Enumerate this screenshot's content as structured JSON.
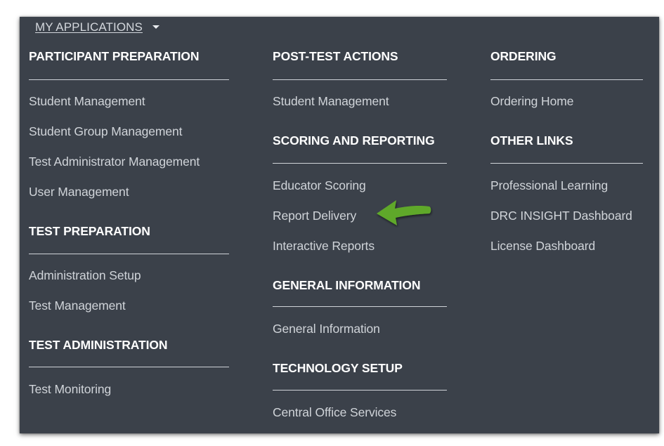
{
  "menu": {
    "title": "MY APPLICATIONS",
    "columns": [
      {
        "sections": [
          {
            "heading": "PARTICIPANT PREPARATION",
            "items": [
              "Student Management",
              "Student Group Management",
              "Test Administrator Management",
              "User Management"
            ]
          },
          {
            "heading": "TEST PREPARATION",
            "items": [
              "Administration Setup",
              "Test Management"
            ]
          },
          {
            "heading": "TEST ADMINISTRATION",
            "items": [
              "Test Monitoring"
            ]
          }
        ]
      },
      {
        "sections": [
          {
            "heading": "POST-TEST ACTIONS",
            "items": [
              "Student Management"
            ]
          },
          {
            "heading": "SCORING AND REPORTING",
            "items": [
              "Educator Scoring",
              "Report Delivery",
              "Interactive Reports"
            ]
          },
          {
            "heading": "GENERAL INFORMATION",
            "items": [
              "General Information"
            ]
          },
          {
            "heading": "TECHNOLOGY SETUP",
            "items": [
              "Central Office Services"
            ]
          }
        ]
      },
      {
        "sections": [
          {
            "heading": "ORDERING",
            "items": [
              "Ordering Home"
            ]
          },
          {
            "heading": "OTHER LINKS",
            "items": [
              "Professional Learning",
              "DRC INSIGHT Dashboard",
              "License Dashboard"
            ]
          }
        ]
      }
    ]
  },
  "colors": {
    "panel_background": "#3b414a",
    "heading_text": "#ffffff",
    "item_text": "#d0d4d9",
    "annotation_arrow": "#5fa82c"
  },
  "annotation": {
    "arrow_icon": "green-arrow-pointing-left",
    "points_to": "Report Delivery"
  }
}
